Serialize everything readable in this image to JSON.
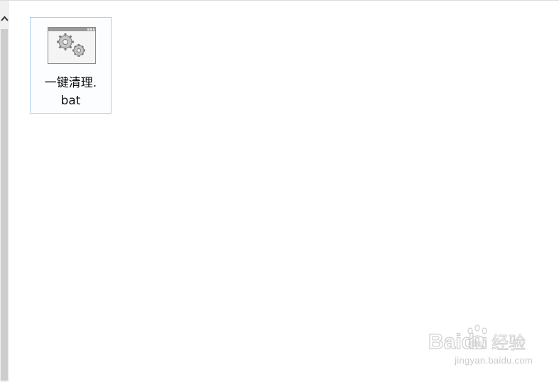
{
  "explorer": {
    "files": [
      {
        "name": "一键清理.\nbat",
        "icon": "batch-file-gears-icon"
      }
    ]
  },
  "watermark": {
    "brand": "Baidu",
    "brand_cn": "经验",
    "url": "jingyan.baidu.com"
  }
}
